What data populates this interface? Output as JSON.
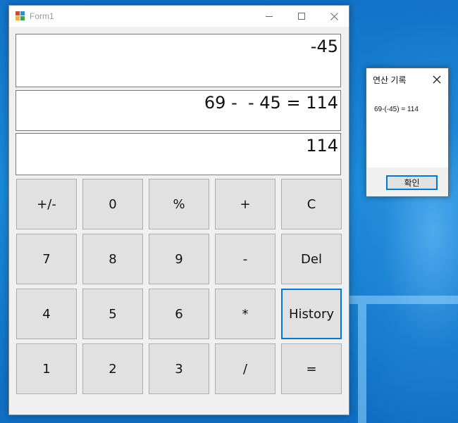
{
  "window": {
    "title": "Form1",
    "min_icon": "minimize-icon",
    "max_icon": "maximize-icon",
    "close_icon": "close-icon"
  },
  "display": {
    "input": "-45",
    "expression": "69 -  - 45 = 114",
    "result": "114"
  },
  "keypad": [
    {
      "label": "+/-",
      "name": "negate-button"
    },
    {
      "label": "0",
      "name": "digit-0-button"
    },
    {
      "label": "%",
      "name": "percent-button"
    },
    {
      "label": "+",
      "name": "plus-button"
    },
    {
      "label": "C",
      "name": "clear-button"
    },
    {
      "label": "7",
      "name": "digit-7-button"
    },
    {
      "label": "8",
      "name": "digit-8-button"
    },
    {
      "label": "9",
      "name": "digit-9-button"
    },
    {
      "label": "-",
      "name": "minus-button"
    },
    {
      "label": "Del",
      "name": "delete-button"
    },
    {
      "label": "4",
      "name": "digit-4-button"
    },
    {
      "label": "5",
      "name": "digit-5-button"
    },
    {
      "label": "6",
      "name": "digit-6-button"
    },
    {
      "label": "*",
      "name": "multiply-button"
    },
    {
      "label": "History",
      "name": "history-button",
      "focused": true
    },
    {
      "label": "1",
      "name": "digit-1-button"
    },
    {
      "label": "2",
      "name": "digit-2-button"
    },
    {
      "label": "3",
      "name": "digit-3-button"
    },
    {
      "label": "/",
      "name": "divide-button"
    },
    {
      "label": "=",
      "name": "equals-button"
    }
  ],
  "history_dialog": {
    "title": "연산 기록",
    "entries": [
      "69-(-45) = 114"
    ],
    "ok_label": "확인"
  },
  "colors": {
    "focus": "#0078d7",
    "button_face": "#e1e1e1",
    "desktop": "#1273c9"
  }
}
